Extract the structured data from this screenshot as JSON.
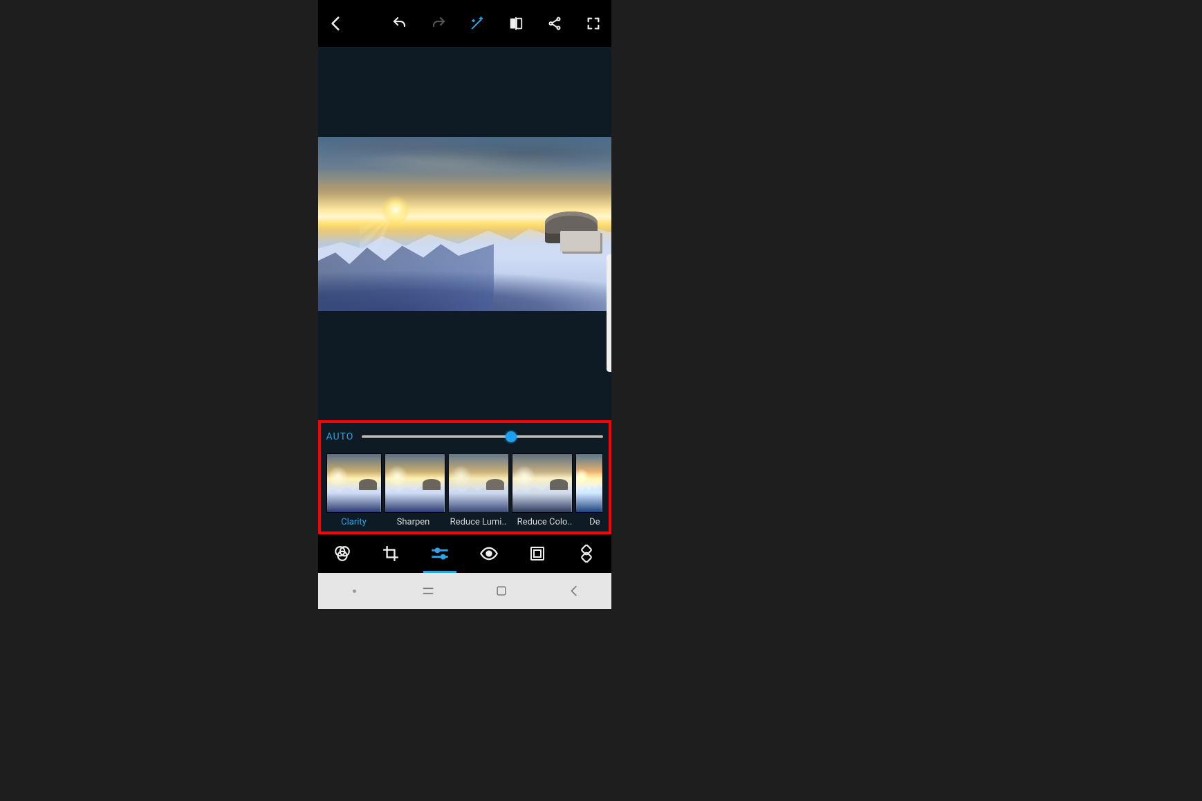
{
  "toolbar": {
    "back": "back",
    "undo": "undo",
    "redo": "redo",
    "magic": "auto-enhance",
    "compare": "compare",
    "share": "share",
    "fullscreen": "fullscreen"
  },
  "adjust": {
    "auto_label": "AUTO",
    "slider_value": 62,
    "presets": [
      {
        "label": "Clarity",
        "active": true
      },
      {
        "label": "Sharpen",
        "active": false
      },
      {
        "label": "Reduce Lumi..",
        "active": false
      },
      {
        "label": "Reduce Colo..",
        "active": false
      },
      {
        "label": "De",
        "active": false
      }
    ]
  },
  "tools": {
    "looks": "looks",
    "crop": "crop",
    "adjust": "adjust",
    "redeye": "red-eye",
    "frame": "frame",
    "heal": "heal"
  },
  "nav": {
    "recents": "recents",
    "home": "home",
    "back": "back"
  },
  "colors": {
    "accent": "#2aa6e8",
    "highlight_border": "#ff0000"
  }
}
